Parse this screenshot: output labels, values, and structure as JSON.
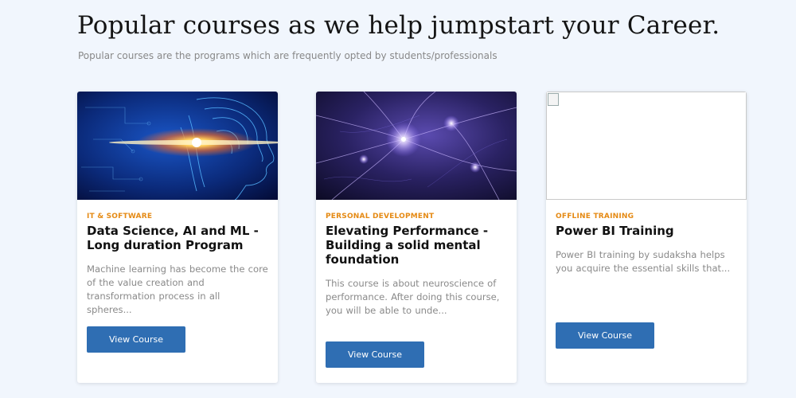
{
  "header": {
    "title": "Popular courses as we help jumpstart your Career.",
    "subtitle": "Popular courses are the programs which are frequently opted by students/professionals"
  },
  "courses": [
    {
      "category": "IT & SOFTWARE",
      "title": "Data Science, AI and ML - Long duration Program",
      "description": "Machine learning has become the core of the value creation and transformation process in all spheres...",
      "button": "View Course",
      "image": "ai-head-illustration"
    },
    {
      "category": "PERSONAL DEVELOPMENT",
      "title": "Elevating Performance - Building a solid mental foundation",
      "description": "This course is about neuroscience of performance. After doing this course, you will be able to unde...",
      "button": "View Course",
      "image": "neural-network-illustration"
    },
    {
      "category": "OFFLINE TRAINING",
      "title": "Power BI Training",
      "description": "Power BI training by sudaksha helps you acquire the essential skills that...",
      "button": "View Course",
      "image": "broken-image"
    }
  ],
  "colors": {
    "background": "#f1f6fd",
    "category": "#e58a14",
    "button": "#2f6eb3"
  }
}
